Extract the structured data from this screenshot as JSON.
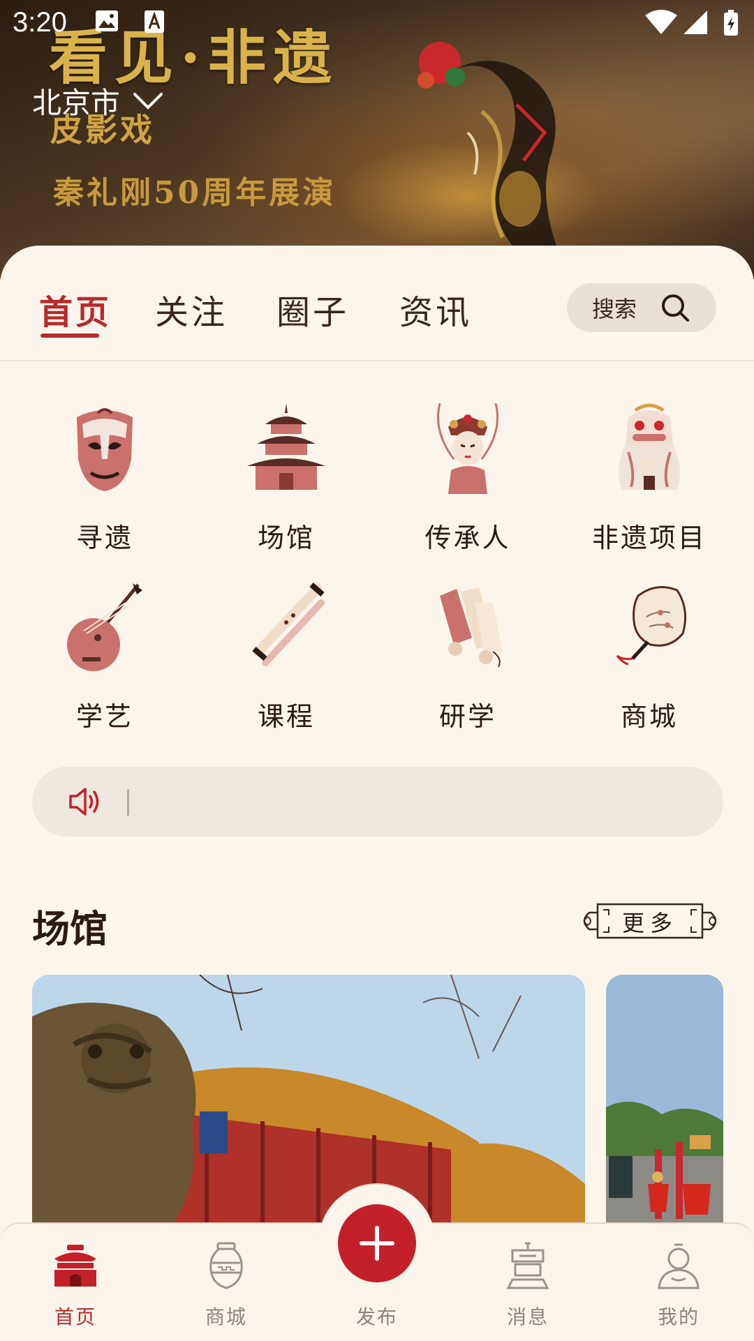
{
  "status_bar": {
    "time": "3:20"
  },
  "banner": {
    "title": "看见·非遗",
    "subtitle1": "皮影戏",
    "subtitle2": "秦礼刚50周年展演"
  },
  "location": {
    "city": "北京市"
  },
  "tabs": [
    {
      "label": "首页",
      "active": true
    },
    {
      "label": "关注",
      "active": false
    },
    {
      "label": "圈子",
      "active": false
    },
    {
      "label": "资讯",
      "active": false
    }
  ],
  "search": {
    "label": "搜索"
  },
  "grid": [
    {
      "label": "寻遗",
      "icon": "opera-mask-icon"
    },
    {
      "label": "场馆",
      "icon": "temple-icon"
    },
    {
      "label": "传承人",
      "icon": "opera-performer-icon"
    },
    {
      "label": "非遗项目",
      "icon": "lion-dance-icon"
    },
    {
      "label": "学艺",
      "icon": "pipa-icon"
    },
    {
      "label": "课程",
      "icon": "flute-icon"
    },
    {
      "label": "研学",
      "icon": "scrolls-icon"
    },
    {
      "label": "商城",
      "icon": "fan-icon"
    }
  ],
  "notice": {
    "icon": "speaker-icon",
    "text": ""
  },
  "section": {
    "title": "场馆",
    "more_label": "更多"
  },
  "bottom_nav": {
    "items": [
      {
        "label": "首页",
        "icon": "home-pavilion-icon",
        "active": true
      },
      {
        "label": "商城",
        "icon": "vase-icon",
        "active": false
      },
      {
        "label": "发布",
        "icon": "plus-icon",
        "active": false
      },
      {
        "label": "消息",
        "icon": "message-icon",
        "active": false
      },
      {
        "label": "我的",
        "icon": "profile-icon",
        "active": false
      }
    ]
  },
  "colors": {
    "accent": "#b82a2a",
    "background": "#fbf5ec",
    "fab": "#c4202a"
  }
}
